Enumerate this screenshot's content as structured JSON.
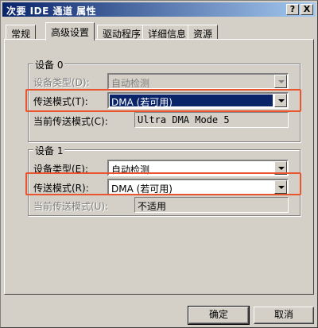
{
  "window": {
    "title": "次要 IDE 通道 属性",
    "help_label": "?",
    "close_label": "X"
  },
  "tabs": [
    {
      "label": "常规"
    },
    {
      "label": "高级设置"
    },
    {
      "label": "驱动程序"
    },
    {
      "label": "详细信息"
    },
    {
      "label": "资源"
    }
  ],
  "device0": {
    "group_title": "设备 0",
    "device_type_label": "设备类型(D):",
    "device_type_value": "自动检测",
    "transfer_mode_label": "传送模式(T):",
    "transfer_mode_value": "DMA (若可用)",
    "current_mode_label": "当前传送模式(C):",
    "current_mode_value": "Ultra DMA Mode 5"
  },
  "device1": {
    "group_title": "设备 1",
    "device_type_label": "设备类型(E):",
    "device_type_value": "自动检测",
    "transfer_mode_label": "传送模式(R):",
    "transfer_mode_value": "DMA (若可用)",
    "current_mode_label": "当前传送模式(U):",
    "current_mode_value": "不适用"
  },
  "buttons": {
    "ok_label": "确定",
    "cancel_label": "取消"
  },
  "colors": {
    "highlight_box": "#e8552e",
    "selection": "#0a246a",
    "face": "#d4d0c8"
  }
}
